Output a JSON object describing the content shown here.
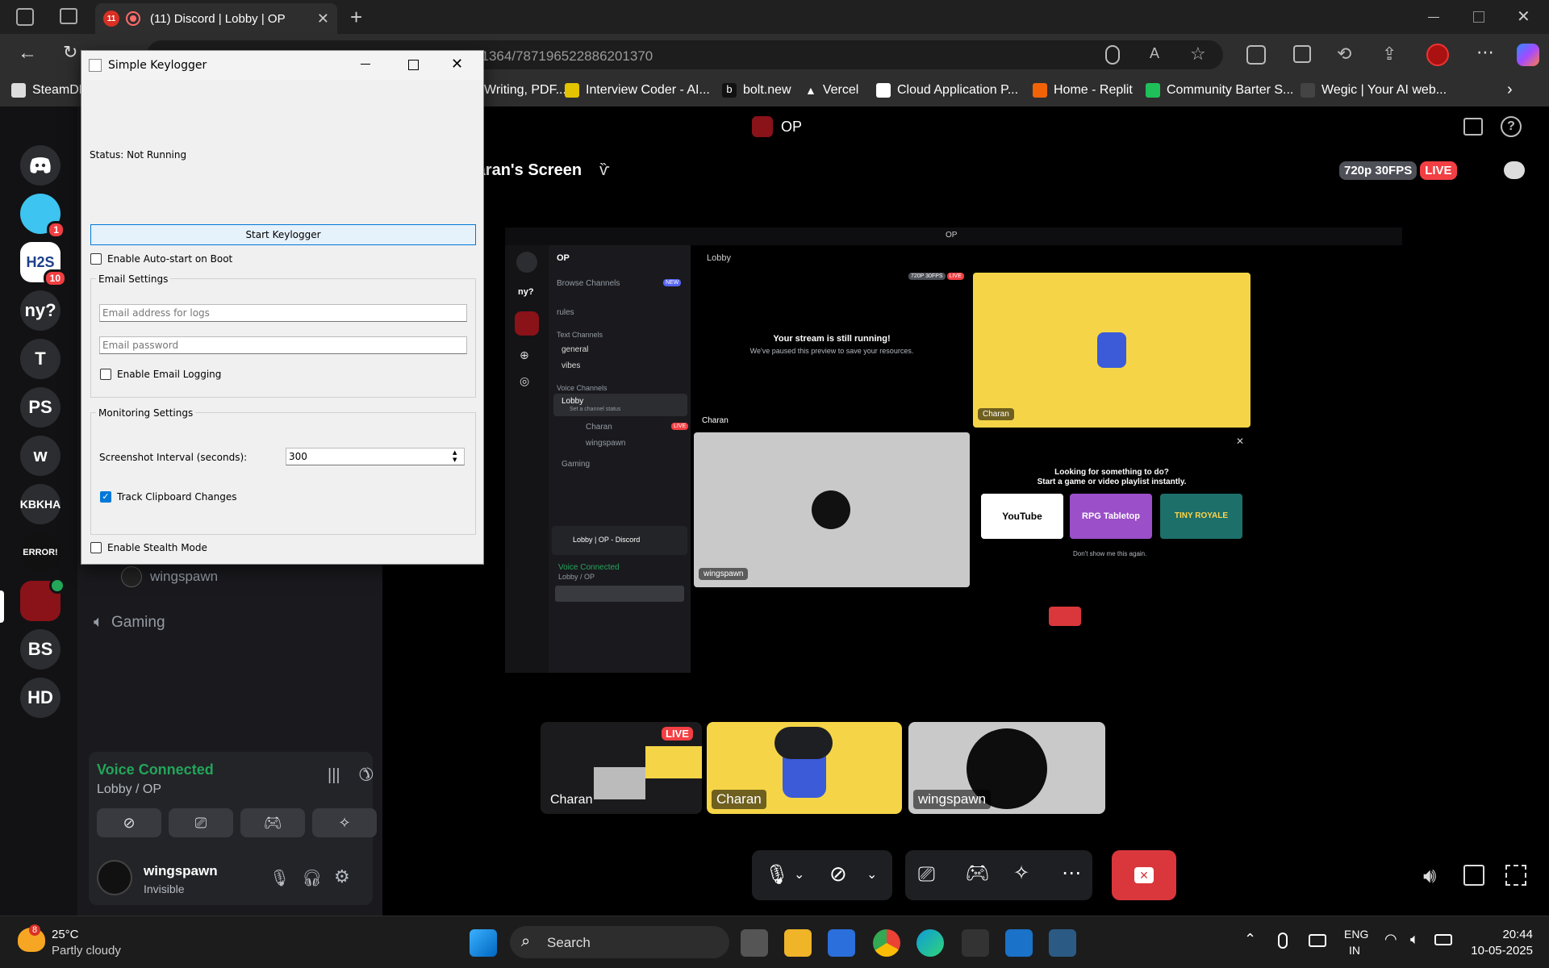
{
  "browser": {
    "tab_badge": "11",
    "tab_title": "(11) Discord | Lobby | OP",
    "url": "https://discord.com/channels/787196522886201364/787196522886201370",
    "bookmarks": [
      "SteamDB",
      "Writing, PDF...",
      "Interview Coder - AI...",
      "bolt.new",
      "Vercel",
      "Cloud Application P...",
      "Home - Replit",
      "Community Barter S...",
      "Wegic | Your AI web..."
    ]
  },
  "discord": {
    "window_title": "OP",
    "servers": [
      {
        "label": "",
        "badge": "1"
      },
      {
        "label": "H2S",
        "badge": "10"
      },
      {
        "label": "ny?"
      },
      {
        "label": "T"
      },
      {
        "label": "PS"
      },
      {
        "label": "w"
      },
      {
        "label": "KBKHA"
      },
      {
        "label": "ERROR!"
      },
      {
        "label": ""
      },
      {
        "label": "BS"
      },
      {
        "label": "HD"
      }
    ],
    "sidebar_user_item": "wingspawn",
    "sidebar_channel": "Gaming",
    "voice_status": "Voice Connected",
    "voice_location": "Lobby / OP",
    "user_name": "wingspawn",
    "user_status": "Invisible",
    "stream_title": "Charan's Screen",
    "quality": "720p 30FPS",
    "live": "LIVE",
    "bottom_tiles": [
      "Charan",
      "Charan",
      "wingspawn"
    ],
    "stream_name_overlay": "Charan"
  },
  "inner_stream": {
    "title": "OP",
    "server_name": "OP",
    "browse": "Browse Channels",
    "new_badge": "NEW",
    "rules": "rules",
    "text_channels": "Text Channels",
    "general": "general",
    "vibes": "vibes",
    "voice_channels": "Voice Channels",
    "lobby": "Lobby",
    "channel_status": "Set a channel status",
    "member1": "Charan",
    "member2": "wingspawn",
    "gaming": "Gaming",
    "header": "Lobby",
    "popout_title": "Lobby | OP - Discord",
    "vc_status": "Voice Connected",
    "vc_loc": "Lobby / OP",
    "paused_title": "Your stream is still running!",
    "paused_sub": "We've paused this preview to save your resources.",
    "tile1_label": "Charan",
    "tile2_label": "Charan",
    "tile3_label": "wingspawn",
    "activity_title": "Looking for something to do?",
    "activity_sub": "Start a game or video playlist instantly.",
    "activities": [
      "YouTube",
      "RPG Tabletop",
      "TINY ROYALE"
    ],
    "dont_show": "Don't show me this again.",
    "quality": "720P 30FPS",
    "live": "LIVE"
  },
  "keylogger": {
    "title": "Simple Keylogger",
    "status": "Status: Not Running",
    "start_button": "Start Keylogger",
    "autostart": "Enable Auto-start on Boot",
    "email_group": "Email Settings",
    "email_placeholder": "Email address for logs",
    "password_placeholder": "Email password",
    "email_logging": "Enable Email Logging",
    "monitor_group": "Monitoring Settings",
    "interval_label": "Screenshot Interval (seconds):",
    "interval_value": "300",
    "clipboard": "Track Clipboard Changes",
    "clipboard_checked": true,
    "stealth": "Enable Stealth Mode"
  },
  "taskbar": {
    "temp": "25°C",
    "weather": "Partly cloudy",
    "weather_badge": "8",
    "search": "Search",
    "lang1": "ENG",
    "lang2": "IN",
    "time": "20:44",
    "date": "10-05-2025"
  },
  "colors": {
    "discord_bg": "#000000",
    "live_red": "#f23f43",
    "voice_green": "#23a55a",
    "blurple": "#5865f2",
    "yellow_tile": "#f5d547"
  }
}
